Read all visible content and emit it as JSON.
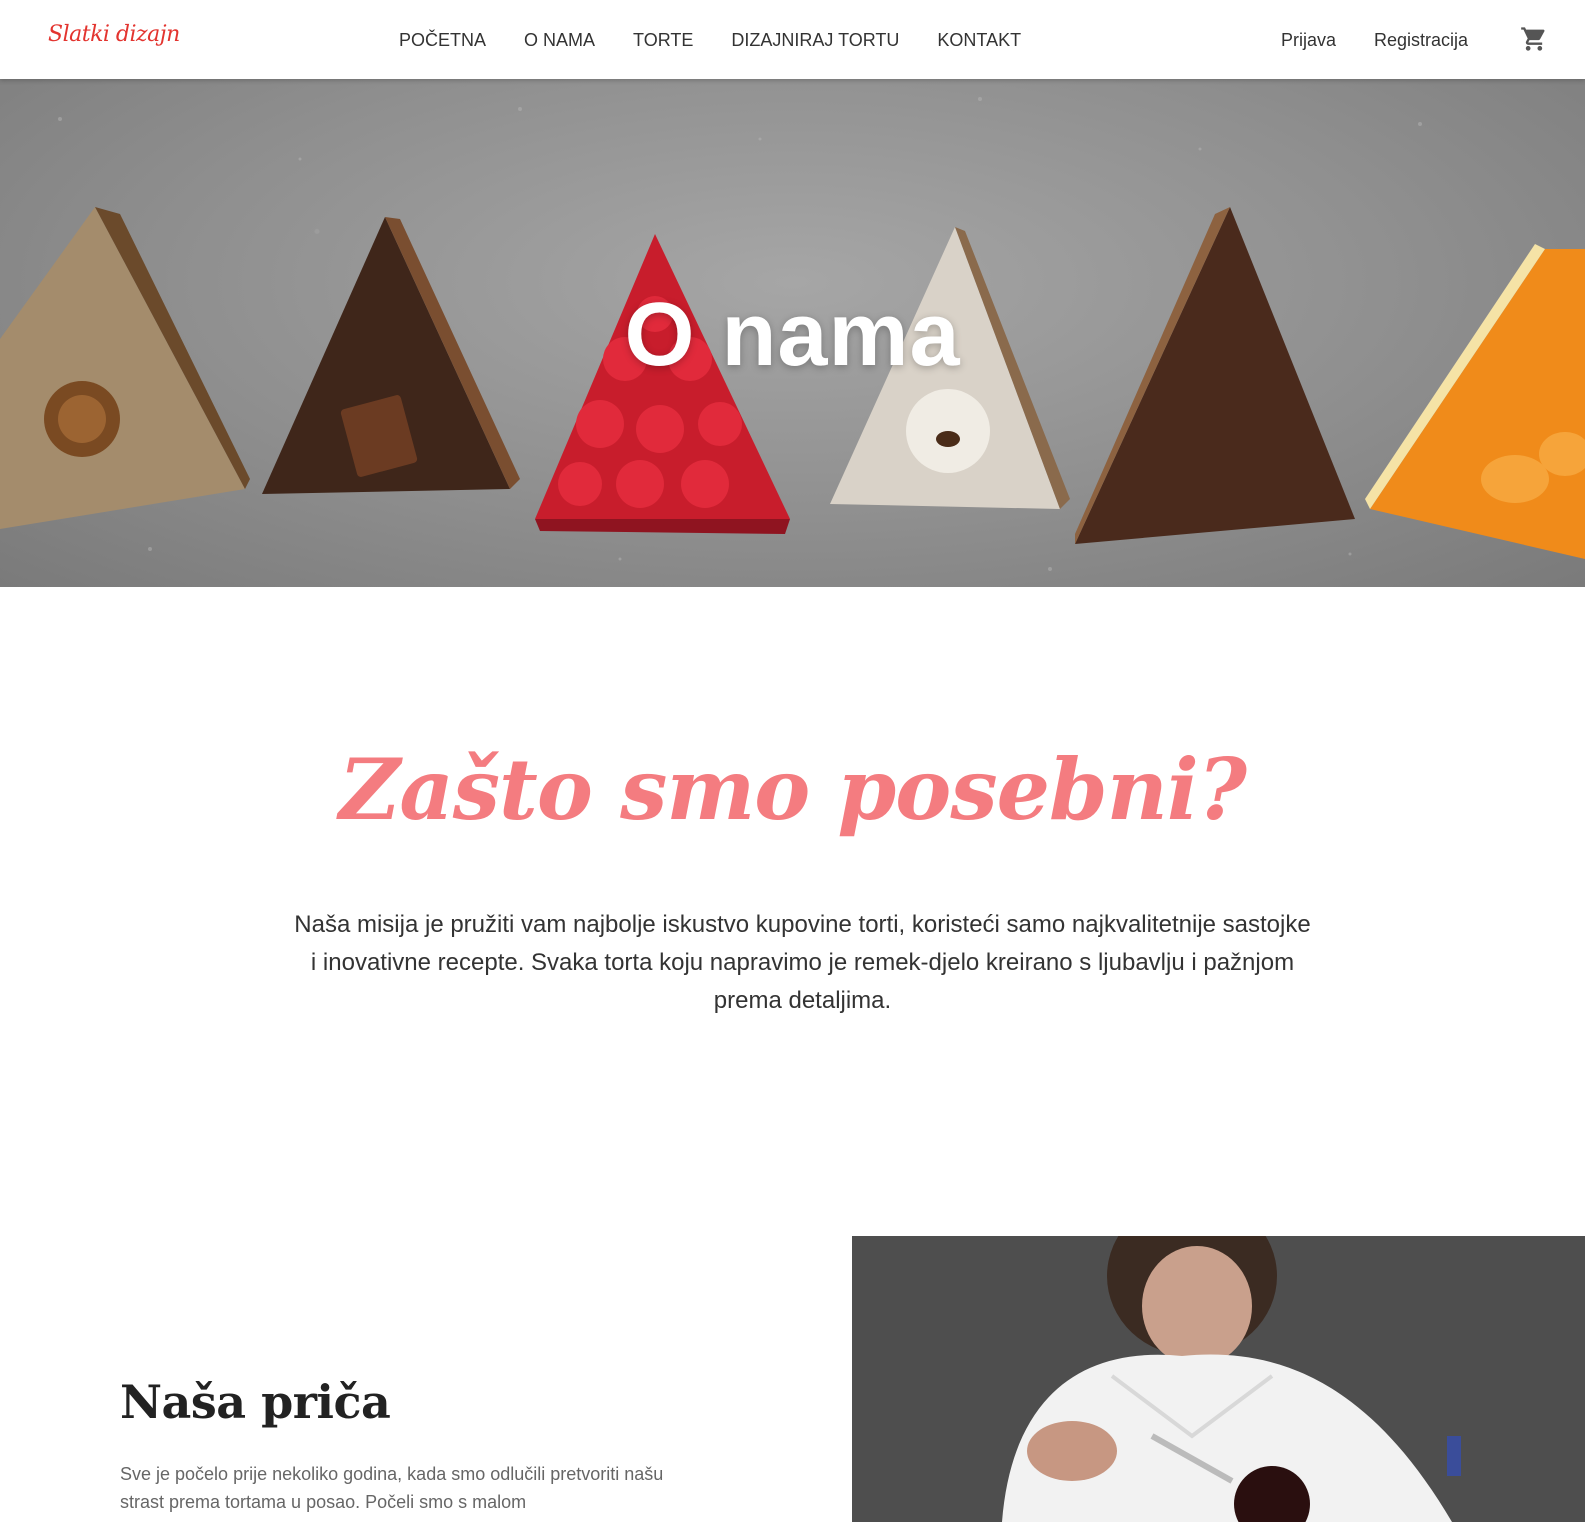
{
  "header": {
    "logo": "Slatki dizajn",
    "nav": [
      "POČETNA",
      "O NAMA",
      "TORTE",
      "DIZAJNIRAJ TORTU",
      "KONTAKT"
    ],
    "auth": {
      "login": "Prijava",
      "register": "Registracija"
    },
    "cart_icon": "shopping-cart-icon"
  },
  "hero": {
    "title": "O nama"
  },
  "mission": {
    "title": "Zašto smo posebni?",
    "text": "Naša misija je pružiti vam najbolje iskustvo kupovine torti, koristeći samo najkvalitetnije sastojke i inovativne recepte. Svaka torta koju napravimo je remek-djelo kreirano s ljubavlju i pažnjom prema detaljima."
  },
  "story": {
    "title": "Naša priča",
    "text": "Sve je počelo prije nekoliko godina, kada smo odlučili pretvoriti našu strast prema tortama u posao. Počeli smo s malom"
  },
  "colors": {
    "accent": "#f47c80",
    "logo": "#e3342f",
    "text": "#333333"
  }
}
